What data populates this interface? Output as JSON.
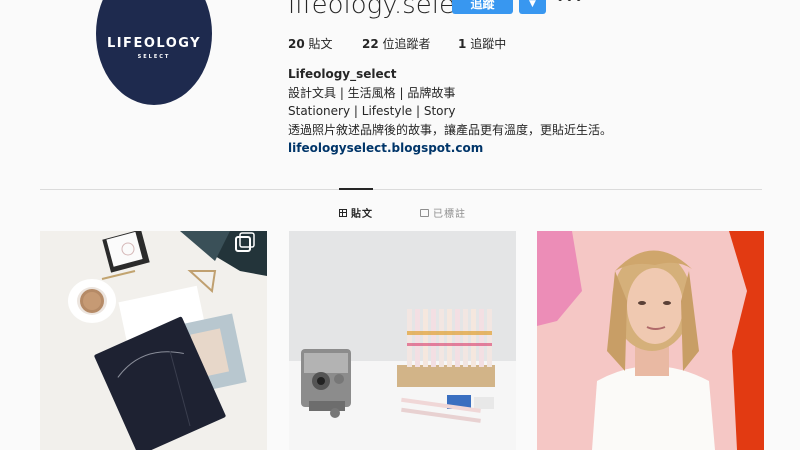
{
  "profile": {
    "username": "lifeology.select",
    "follow_label": "追蹤",
    "dropdown_symbol": "▼",
    "more_symbol": "•••",
    "logo_text": "LIFEOLOGY",
    "logo_sub": "SELECT",
    "stats": [
      {
        "value": "20",
        "label": "貼文"
      },
      {
        "value": "22",
        "label": "位追蹤者"
      },
      {
        "value": "1",
        "label": "追蹤中"
      }
    ],
    "bio": {
      "name": "Lifeology_select",
      "line1": "設計文具 | 生活風格 | 品牌故事",
      "line2": "Stationery | Lifestyle | Story",
      "line3": "透過照片敘述品牌後的故事，讓產品更有溫度，更貼近生活。",
      "link": "lifeologyselect.blogspot.com"
    }
  },
  "tabs": [
    {
      "label": "貼文",
      "active": true
    },
    {
      "label": "已標註",
      "active": false
    }
  ],
  "colors": {
    "accent": "#3897f0",
    "avatar_bg": "#1e2a4e",
    "link": "#003569"
  },
  "posts": [
    {
      "icon": "carousel-icon"
    },
    {
      "icon": ""
    },
    {
      "icon": ""
    }
  ]
}
